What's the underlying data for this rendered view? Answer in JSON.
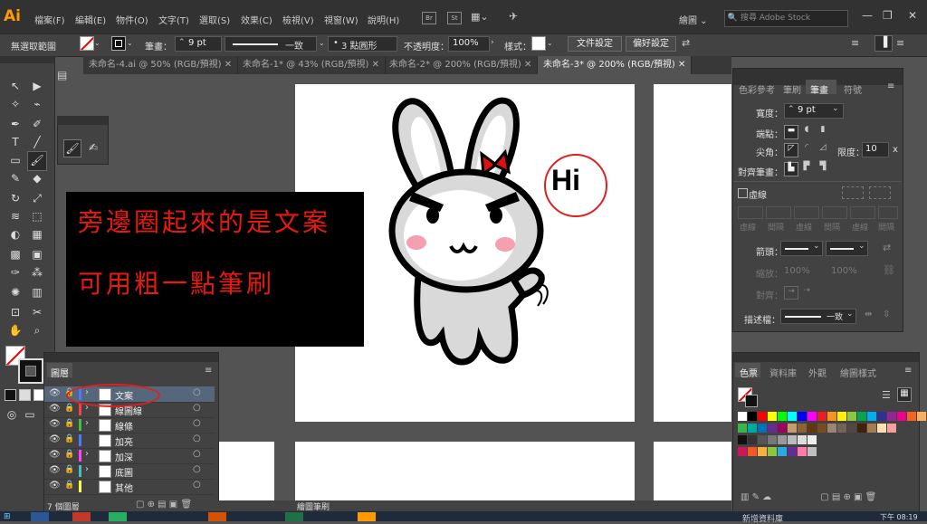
{
  "app": {
    "logo": "Ai",
    "workspace": "繪圖",
    "search_placeholder": "搜尋 Adobe Stock"
  },
  "menu": [
    "檔案(F)",
    "編輯(E)",
    "物件(O)",
    "文字(T)",
    "選取(S)",
    "效果(C)",
    "檢視(V)",
    "視窗(W)",
    "說明(H)"
  ],
  "menu_icons": {
    "bridge": "Br",
    "stock": "St"
  },
  "control": {
    "selection": "無選取範圍",
    "stroke_label": "筆畫：",
    "stroke_value": "9 pt",
    "profile": "一致",
    "brush": "3 點圓形",
    "opacity_label": "不透明度：",
    "opacity": "100%",
    "style_label": "樣式：",
    "doc_setup": "文件設定",
    "prefs": "偏好設定"
  },
  "tabs": [
    "未命名-4.ai @ 50% (RGB/預視)",
    "未命名-1* @ 43% (RGB/預視)",
    "未命名-2* @ 200% (RGB/預視)",
    "未命名-3* @ 200% (RGB/預視)"
  ],
  "artwork": {
    "hi_text": "Hi",
    "note_line1": "旁邊圈起來的是文案",
    "note_line2": "可用粗一點筆刷"
  },
  "stroke_panel": {
    "tabs": [
      "色彩參考",
      "筆刷",
      "筆畫",
      "符號"
    ],
    "weight_label": "寬度：",
    "weight": "9 pt",
    "cap_label": "端點：",
    "corner_label": "尖角：",
    "limit_label": "限度：",
    "limit": "10",
    "limit_unit": "x",
    "align_label": "對齊筆畫：",
    "dashed_label": "虛線",
    "dash_labels": [
      "虛線",
      "間隔",
      "虛線",
      "間隔",
      "虛線",
      "間隔"
    ],
    "arrow_label": "箭頭：",
    "scale_label": "縮放：",
    "scale1": "100%",
    "scale2": "100%",
    "align2_label": "對齊：",
    "profile_label": "描述檔：",
    "profile": "一致"
  },
  "layers_panel": {
    "tab": "圖層",
    "count": "7 個圖層",
    "layers": [
      {
        "name": "文案",
        "color": "#4a7bff"
      },
      {
        "name": "線圖線",
        "color": "#ff4040"
      },
      {
        "name": "線條",
        "color": "#40c040"
      },
      {
        "name": "加亮",
        "color": "#4a7bff"
      },
      {
        "name": "加深",
        "color": "#ff40ff"
      },
      {
        "name": "底圖",
        "color": "#40c0c0"
      },
      {
        "name": "其他",
        "color": "#ffff40"
      }
    ]
  },
  "swatches_panel": {
    "tabs": [
      "色票",
      "資料庫",
      "外觀",
      "繪圖樣式"
    ],
    "rows": [
      [
        "#ffffff",
        "#000000",
        "#ff0000",
        "#ffff00",
        "#00ff00",
        "#00ffff",
        "#0000ff",
        "#ff00ff",
        "#ed1c24",
        "#f7941d",
        "#fff200",
        "#8dc63f",
        "#00a651",
        "#00aeef",
        "#2e3192",
        "#92278f",
        "#ec008c",
        "#f26522",
        "#fbaf5d",
        "#ffd700",
        "#c4df9b"
      ],
      [
        "#39b54a",
        "#00a99d",
        "#0072bc",
        "#662d91",
        "#9e005d",
        "#c69c6d",
        "#8c6239",
        "#603913",
        "#754c24",
        "#998675",
        "#736357",
        "#534741",
        "#42210b",
        "#a67c52",
        "#ffe0b0",
        "#f5a0a0"
      ],
      [
        "#111111",
        "#333333",
        "#555555",
        "#777777",
        "#999999",
        "#bbbbbb",
        "#dddddd",
        "#eeeeee"
      ],
      [
        "#d4145a",
        "#f15a24",
        "#fbb03b",
        "#8cc63f",
        "#29abe2",
        "#662d91",
        "#ff7bac",
        "#c0c0c0"
      ]
    ]
  },
  "status": {
    "artboard": "繪圖筆刷",
    "libraries": "新增資料庫",
    "time": "08:19",
    "day": "下午"
  },
  "colors": {
    "accent_orange": "#ff9a00",
    "selection_blue": "#56677b",
    "note_red": "#e8190f",
    "circle_red": "#e02020"
  }
}
